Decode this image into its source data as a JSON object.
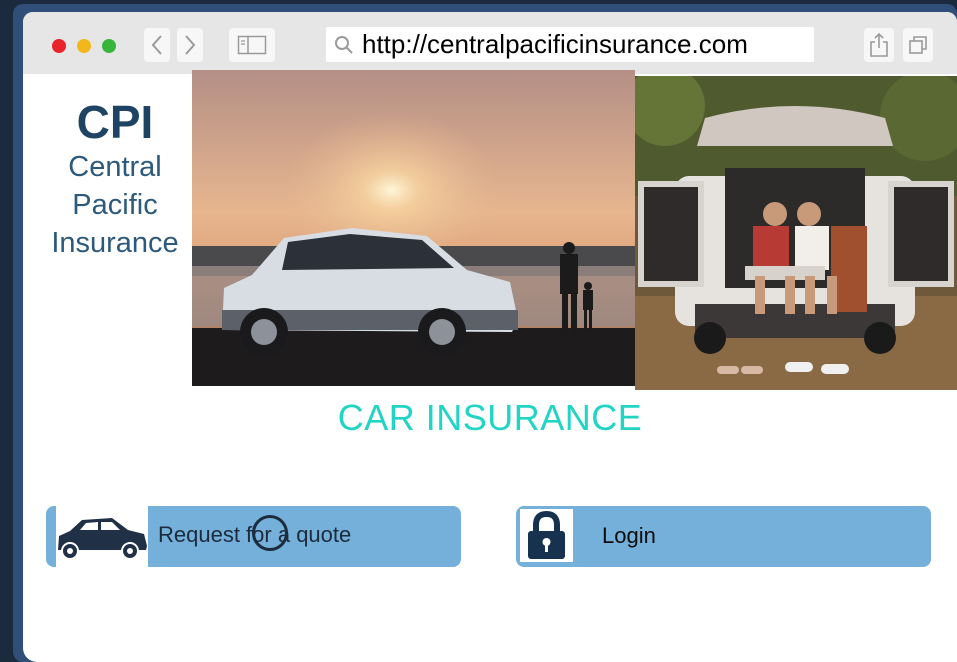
{
  "browser": {
    "url": "http://centralpacificinsurance.com",
    "traffic_lights": {
      "close": "#e8242a",
      "minimize": "#f2b71a",
      "zoom": "#37b43a"
    },
    "icons": [
      "back-icon",
      "forward-icon",
      "sidebar-icon",
      "search-icon",
      "share-icon",
      "tabs-icon"
    ]
  },
  "logo": {
    "abbr": "CPI",
    "line1": "Central",
    "line2": "Pacific",
    "line3": "Insurance"
  },
  "heading": "CAR INSURANCE",
  "actions": {
    "quote": {
      "label": "Request for a quote",
      "icon": "car-icon"
    },
    "login": {
      "label": "Login",
      "icon": "lock-icon"
    }
  },
  "colors": {
    "frame": "#2f4f79",
    "button": "#74b0da",
    "heading": "#22d4c4",
    "logo": "#1f4463"
  }
}
